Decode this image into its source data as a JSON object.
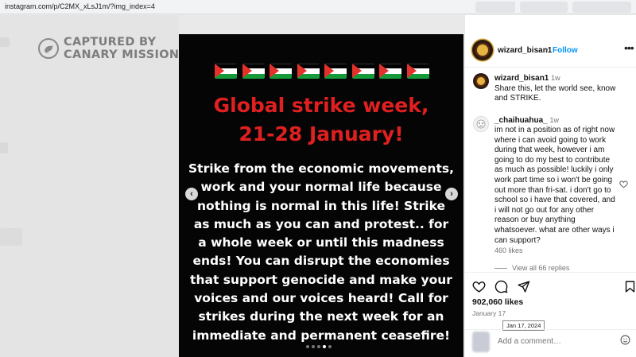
{
  "browser": {
    "url": "instagram.com/p/C2MX_xLsJ1m/?img_index=4"
  },
  "watermark": {
    "line1": "CAPTURED BY",
    "line2": "CANARY MISSION"
  },
  "post_image": {
    "flag_count": 8,
    "headline_line1": "Global strike week,",
    "headline_line2": "21-28 January!",
    "body": "Strike from the economic movements, work and your normal life because nothing is normal in this life! Strike as much as you can and protest.. for a whole week or until this madness ends! You can disrupt the economies that support genocide and make your voices and our voices heard! Call for strikes during the next week for an immediate and permanent ceasefire!",
    "carousel_index": 4,
    "carousel_total": 5,
    "colors": {
      "headline": "#e02020",
      "flag_green": "#169b3b",
      "flag_red": "#e4312b"
    }
  },
  "header": {
    "username": "wizard_bisan1",
    "separator": "•",
    "follow_label": "Follow",
    "more_icon": "more-horizontal-icon"
  },
  "caption": {
    "username": "wizard_bisan1",
    "time": "1w",
    "text": "Share this, let the world see, know and STRIKE."
  },
  "comment": {
    "username": "_chaihuahua_",
    "time": "1w",
    "text": "im not in a position as of right now where i can avoid going to work during that week, however i am going to do my best to contribute as much as possible! luckily i only work part time so i won't be going out more than fri-sat. i don't go to school so i have that covered, and i will not go out for any other reason or buy anything whatsoever. what are other ways i can support?",
    "likes": "460 likes",
    "view_replies": "View all 66 replies"
  },
  "engagement": {
    "likes": "902,060 likes",
    "date": "January 17",
    "tooltip": "Jan 17, 2024"
  },
  "add_comment": {
    "placeholder": "Add a comment…"
  }
}
